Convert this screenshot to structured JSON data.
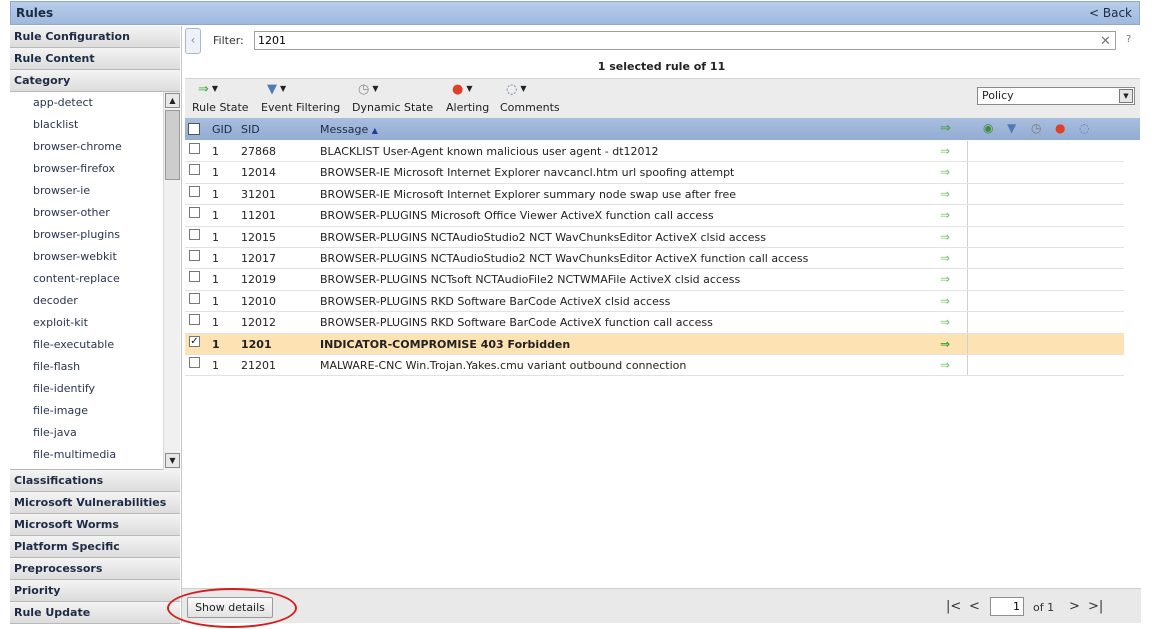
{
  "header": {
    "title": "Rules",
    "back_label": "< Back"
  },
  "sidebar": {
    "top_sections": [
      "Rule Configuration",
      "Rule Content",
      "Category"
    ],
    "category_items": [
      "app-detect",
      "blacklist",
      "browser-chrome",
      "browser-firefox",
      "browser-ie",
      "browser-other",
      "browser-plugins",
      "browser-webkit",
      "content-replace",
      "decoder",
      "exploit-kit",
      "file-executable",
      "file-flash",
      "file-identify",
      "file-image",
      "file-java",
      "file-multimedia"
    ],
    "bottom_sections": [
      "Classifications",
      "Microsoft Vulnerabilities",
      "Microsoft Worms",
      "Platform Specific",
      "Preprocessors",
      "Priority",
      "Rule Update"
    ]
  },
  "filter": {
    "label": "Filter:",
    "value": "1201",
    "help": "?"
  },
  "selection_info": "1 selected rule of 11",
  "toolbar": {
    "buttons": [
      {
        "label": "Rule State",
        "icon": "arrow-right-icon"
      },
      {
        "label": "Event Filtering",
        "icon": "funnel-icon"
      },
      {
        "label": "Dynamic State",
        "icon": "clock-icon"
      },
      {
        "label": "Alerting",
        "icon": "alert-icon"
      },
      {
        "label": "Comments",
        "icon": "comment-icon"
      }
    ],
    "policy_value": "Policy"
  },
  "grid": {
    "columns": {
      "gid": "GID",
      "sid": "SID",
      "message": "Message"
    },
    "rows": [
      {
        "gid": "1",
        "sid": "27868",
        "message": "BLACKLIST User-Agent known malicious user agent - dt12012",
        "checked": false
      },
      {
        "gid": "1",
        "sid": "12014",
        "message": "BROWSER-IE Microsoft Internet Explorer navcancl.htm url spoofing attempt",
        "checked": false
      },
      {
        "gid": "1",
        "sid": "31201",
        "message": "BROWSER-IE Microsoft Internet Explorer summary node swap use after free",
        "checked": false
      },
      {
        "gid": "1",
        "sid": "11201",
        "message": "BROWSER-PLUGINS Microsoft Office Viewer ActiveX function call access",
        "checked": false
      },
      {
        "gid": "1",
        "sid": "12015",
        "message": "BROWSER-PLUGINS NCTAudioStudio2 NCT WavChunksEditor ActiveX clsid access",
        "checked": false
      },
      {
        "gid": "1",
        "sid": "12017",
        "message": "BROWSER-PLUGINS NCTAudioStudio2 NCT WavChunksEditor ActiveX function call access",
        "checked": false
      },
      {
        "gid": "1",
        "sid": "12019",
        "message": "BROWSER-PLUGINS NCTsoft NCTAudioFile2 NCTWMAFile ActiveX clsid access",
        "checked": false
      },
      {
        "gid": "1",
        "sid": "12010",
        "message": "BROWSER-PLUGINS RKD Software BarCode ActiveX clsid access",
        "checked": false
      },
      {
        "gid": "1",
        "sid": "12012",
        "message": "BROWSER-PLUGINS RKD Software BarCode ActiveX function call access",
        "checked": false
      },
      {
        "gid": "1",
        "sid": "1201",
        "message": "INDICATOR-COMPROMISE 403 Forbidden",
        "checked": true
      },
      {
        "gid": "1",
        "sid": "21201",
        "message": "MALWARE-CNC Win.Trojan.Yakes.cmu variant outbound connection",
        "checked": false
      }
    ]
  },
  "footer": {
    "show_details_label": "Show details",
    "page_value": "1",
    "of_text": "of 1"
  },
  "colors": {
    "header_blue": "#a9bedd",
    "selected_row": "#fde2b3",
    "highlight_ring": "#d21e1e",
    "state_green": "#7cc06a"
  }
}
